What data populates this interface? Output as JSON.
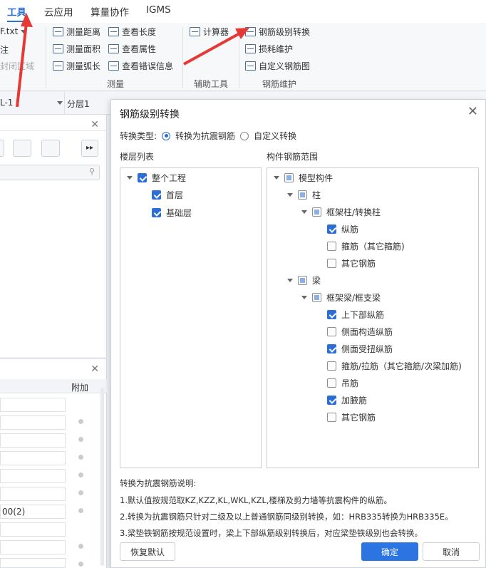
{
  "menubar": {
    "tabs": [
      "工具",
      "云应用",
      "算量协作",
      "IGMS"
    ]
  },
  "ribbon": {
    "file_label": "F.txt",
    "left_items": [
      "注",
      "封闭区域"
    ],
    "measure": [
      "测量距离",
      "测量面积",
      "测量弧长",
      "查看长度",
      "查看属性",
      "查看错误信息"
    ],
    "measure_group": "测量",
    "calc": "计算器",
    "aux_group": "辅助工具",
    "rebar_items": [
      "钢筋级别转换",
      "损耗维护",
      "自定义钢筋图"
    ],
    "rebar_group": "钢筋维护"
  },
  "toolbar2": {
    "left_value": "L-1",
    "right_value": "分层1"
  },
  "leftpanel2": {
    "header": "附加",
    "cell_value": "00(2)"
  },
  "dialog": {
    "title": "钢筋级别转换",
    "type_label": "转换类型:",
    "option1": "转换为抗震钢筋",
    "option2": "自定义转换",
    "floor_list_label": "楼层列表",
    "range_label": "构件钢筋范围",
    "floors": [
      "整个工程",
      "首层",
      "基础层"
    ],
    "tree": [
      "模型构件",
      "柱",
      "框架柱/转换柱",
      "纵筋",
      "箍筋（其它箍筋)",
      "其它钢筋",
      "梁",
      "框架梁/框支梁",
      "上下部纵筋",
      "侧面构造纵筋",
      "侧面受扭纵筋",
      "箍筋/拉筋（其它箍筋/次梁加筋)",
      "吊筋",
      "加腋筋",
      "其它钢筋"
    ],
    "notes": [
      "转换为抗震钢筋说明:",
      "1.默认值按规范取KZ,KZZ,KL,WKL,KZL,楼梯及剪力墙等抗震构件的纵筋。",
      "2.转换为抗震钢筋只针对二级及以上普通钢筋同级别转换，如：HRB335转换为HRB335E。",
      "3.梁垫铁钢筋按规范设置时，梁上下部纵筋级别转换后，对应梁垫铁级别也会转换。"
    ],
    "restore_button": "恢复默认",
    "ok_button": "确定",
    "cancel_button": "取消"
  },
  "colors": {
    "accent": "#2b6fd6",
    "arrow": "#e53935"
  }
}
